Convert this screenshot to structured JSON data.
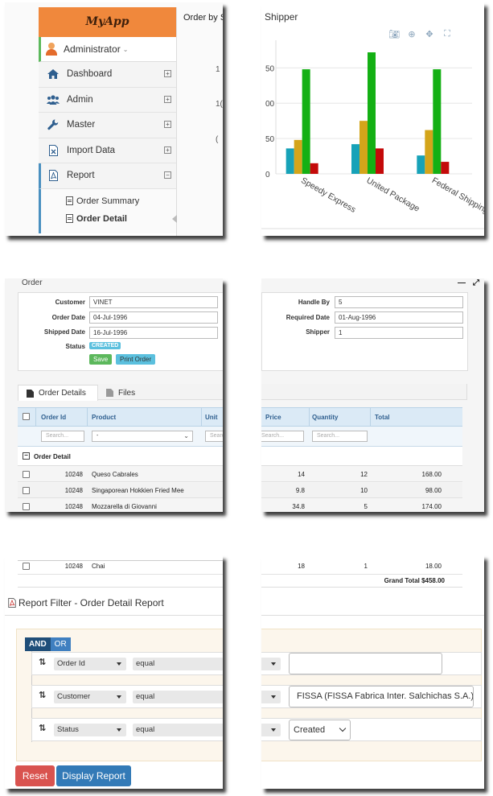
{
  "sidebar": {
    "logo": "MyApp",
    "user": "Administrator",
    "items": [
      {
        "label": "Dashboard",
        "icon": "home-icon"
      },
      {
        "label": "Admin",
        "icon": "users-icon"
      },
      {
        "label": "Master",
        "icon": "wrench-icon"
      },
      {
        "label": "Import Data",
        "icon": "excel-file-icon"
      },
      {
        "label": "Report",
        "icon": "pdf-file-icon"
      }
    ],
    "report_sub": [
      {
        "label": "Order Summary",
        "icon": "pdf-file-icon"
      },
      {
        "label": "Order Detail",
        "icon": "pdf-file-icon"
      }
    ]
  },
  "background_panel": {
    "title": "Order by S",
    "numbers": [
      "1",
      "1(",
      "("
    ]
  },
  "chart_panel": {
    "title": "Shipper",
    "modebar": [
      "camera-icon",
      "zoom-icon",
      "pan-icon",
      "autoscale-icon"
    ]
  },
  "chart_data": {
    "type": "bar",
    "categories": [
      "Speedy Express",
      "United Package",
      "Federal Shipping"
    ],
    "series": [
      {
        "color": "#17a2b8",
        "values": [
          36,
          42,
          26
        ]
      },
      {
        "color": "#d4a51a",
        "values": [
          48,
          75,
          62
        ]
      },
      {
        "color": "#14b014",
        "values": [
          148,
          172,
          148
        ]
      },
      {
        "color": "#c40a0a",
        "values": [
          15,
          36,
          17
        ]
      }
    ],
    "ytick_labels": [
      "50",
      "00",
      "50",
      "0"
    ],
    "ylim": [
      0,
      180
    ],
    "grid": true
  },
  "order": {
    "title": "Order",
    "fields_left": [
      {
        "label": "Customer",
        "value": "VINET"
      },
      {
        "label": "Order Date",
        "value": "04-Jul-1996"
      },
      {
        "label": "Shipped Date",
        "value": "16-Jul-1996"
      }
    ],
    "status_label": "Status",
    "status": "CREATED",
    "save": "Save",
    "print": "Print Order",
    "fields_right": [
      {
        "label": "Handle By",
        "value": "5"
      },
      {
        "label": "Required Date",
        "value": "01-Aug-1996"
      },
      {
        "label": "Shipper",
        "value": "1"
      }
    ],
    "window_buttons": [
      "—",
      "⤢"
    ]
  },
  "tabs": [
    {
      "label": "Order Details",
      "active": true
    },
    {
      "label": "Files",
      "active": false
    }
  ],
  "grid": {
    "columns_left": [
      "Order Id",
      "Product",
      "Unit"
    ],
    "columns_right": [
      "Price",
      "Quantity",
      "Total"
    ],
    "search_placeholder": "Search...",
    "product_filter": "-",
    "group": "Order Detail",
    "rows": [
      {
        "order_id": "10248",
        "product": "Queso Cabrales",
        "price": "14",
        "qty": "12",
        "total": "168.00"
      },
      {
        "order_id": "10248",
        "product": "Singaporean Hokkien Fried Mee",
        "price": "9.8",
        "qty": "10",
        "total": "98.00"
      },
      {
        "order_id": "10248",
        "product": "Mozzarella di Giovanni",
        "price": "34.8",
        "qty": "5",
        "total": "174.00"
      },
      {
        "order_id": "10248",
        "product": "Chai",
        "price": "18",
        "qty": "1",
        "total": "18.00"
      }
    ],
    "grand_total": "Grand Total $458.00"
  },
  "report_filter": {
    "title": "Report Filter - Order Detail Report",
    "and": "AND",
    "or": "OR",
    "rules": [
      {
        "field": "Order Id",
        "operator": "equal",
        "value": ""
      },
      {
        "field": "Customer",
        "operator": "equal",
        "value": "FISSA (FISSA Fabrica Inter. Salchichas S.A.)"
      },
      {
        "field": "Status",
        "operator": "equal",
        "value": "Created"
      }
    ],
    "reset": "Reset",
    "display": "Display Report"
  }
}
